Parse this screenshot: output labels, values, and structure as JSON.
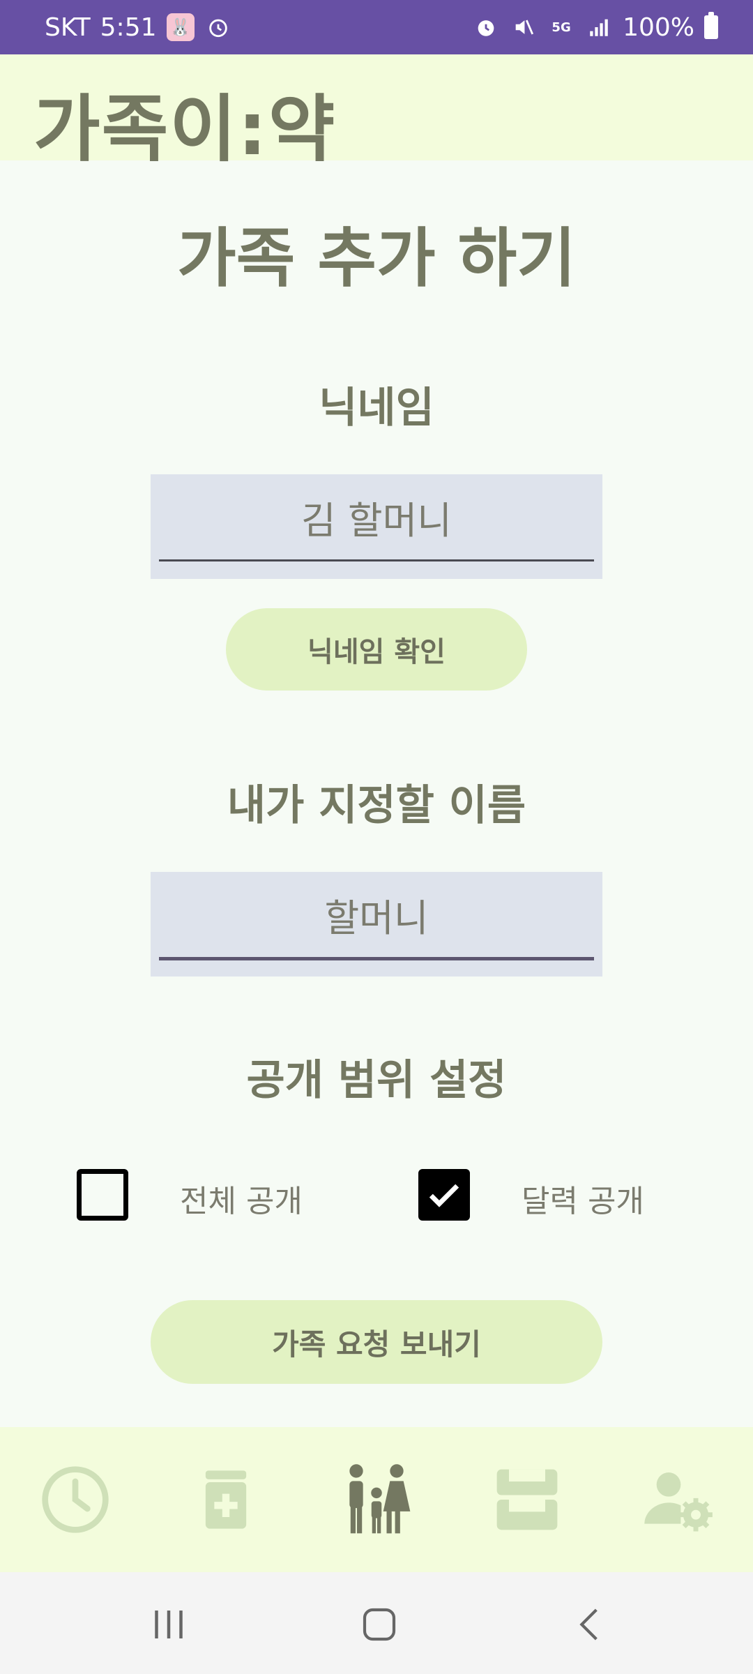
{
  "status_bar": {
    "carrier": "SKT",
    "time": "5:51",
    "battery": "100%",
    "network": "5G"
  },
  "app_bar": {
    "title": "가족이:약"
  },
  "page": {
    "title": "가족 추가 하기",
    "nickname_label": "닉네임",
    "nickname_value": "김 할머니",
    "nickname_check_button": "닉네임 확인",
    "alias_label": "내가 지정할 이름",
    "alias_value": "할머니",
    "visibility_label": "공개 범위 설정",
    "options": [
      {
        "label": "전체 공개",
        "checked": false
      },
      {
        "label": "달력 공개",
        "checked": true
      }
    ],
    "send_button": "가족 요청 보내기"
  },
  "bottom_nav": {
    "items": [
      {
        "icon": "clock-icon",
        "active": false
      },
      {
        "icon": "medicine-icon",
        "active": false
      },
      {
        "icon": "family-icon",
        "active": true
      },
      {
        "icon": "inbox-icon",
        "active": false
      },
      {
        "icon": "user-settings-icon",
        "active": false
      }
    ]
  },
  "colors": {
    "status_bar": "#6750a4",
    "app_bar": "#f3fcdc",
    "text": "#747861",
    "button": "#e2f2c3",
    "field": "#dee3ec",
    "nav_inactive": "#cfe0b8",
    "nav_active": "#747861"
  }
}
